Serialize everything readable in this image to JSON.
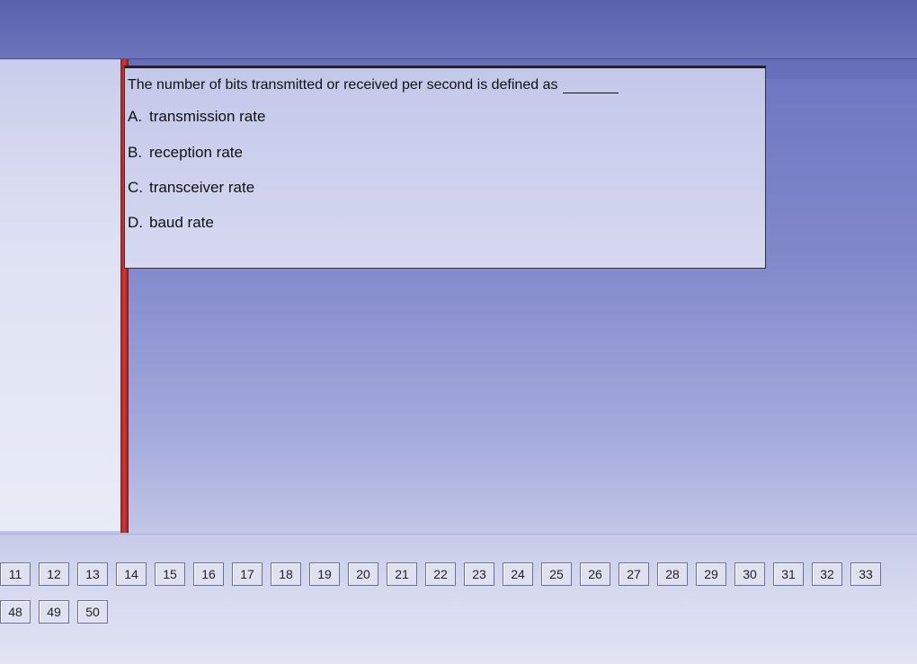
{
  "question": {
    "text": "The number of bits transmitted or received per second is defined as",
    "options": [
      {
        "letter": "A.",
        "label": "transmission rate"
      },
      {
        "letter": "B.",
        "label": "reception rate"
      },
      {
        "letter": "C.",
        "label": "transceiver rate"
      },
      {
        "letter": "D.",
        "label": "baud rate"
      }
    ]
  },
  "navigation": {
    "row1": [
      "11",
      "12",
      "13",
      "14",
      "15",
      "16",
      "17",
      "18",
      "19",
      "20",
      "21",
      "22",
      "23",
      "24",
      "25",
      "26",
      "27",
      "28",
      "29",
      "30",
      "31",
      "32",
      "33"
    ],
    "row2": [
      "48",
      "49",
      "50"
    ]
  }
}
